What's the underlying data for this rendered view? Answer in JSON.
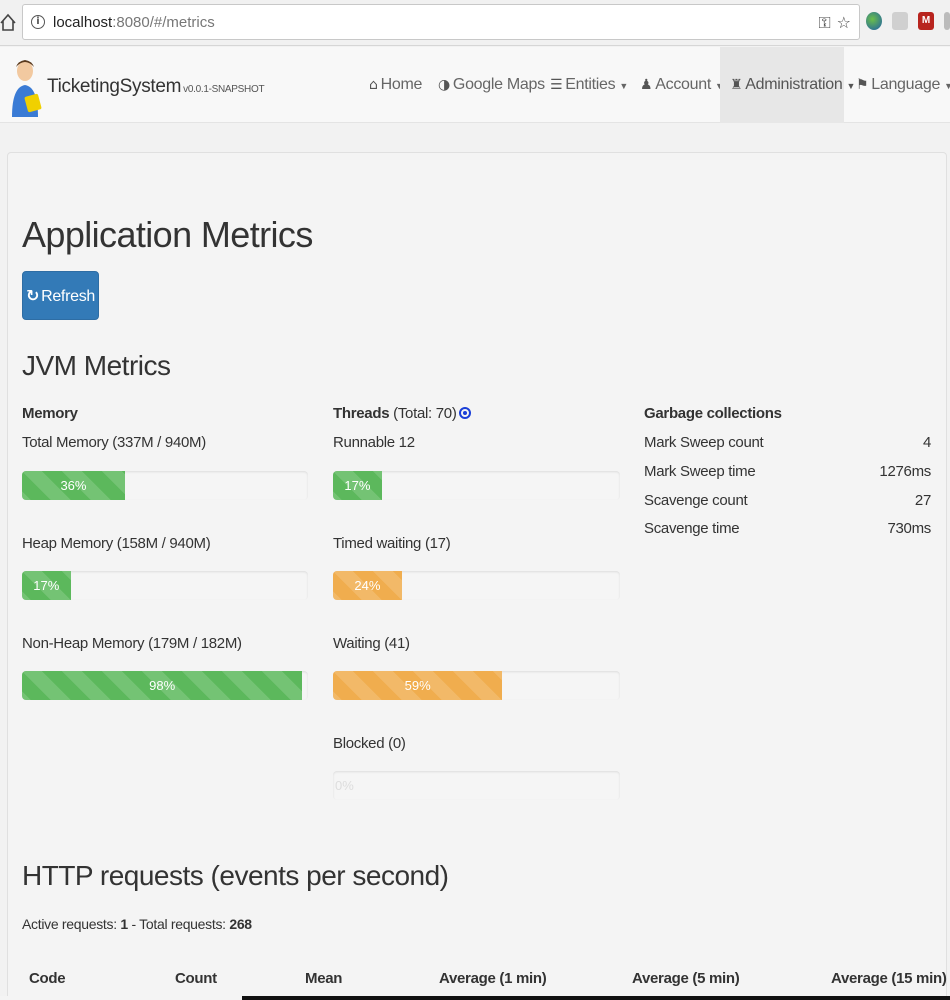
{
  "browser": {
    "url_host": "localhost",
    "url_rest": ":8080/#/metrics"
  },
  "navbar": {
    "brand": "TicketingSystem",
    "version": "v0.0.1-SNAPSHOT",
    "items": [
      {
        "label": "Home",
        "icon": "home-icon"
      },
      {
        "label": "Google Maps",
        "icon": "globe-icon"
      },
      {
        "label": "Entities",
        "icon": "list-icon"
      },
      {
        "label": "Account",
        "icon": "user-icon"
      },
      {
        "label": "Administration",
        "icon": "tower-icon"
      },
      {
        "label": "Language",
        "icon": "flag-icon"
      }
    ]
  },
  "page": {
    "title": "Application Metrics",
    "refresh_label": "Refresh"
  },
  "jvm": {
    "title": "JVM Metrics",
    "memory": {
      "heading": "Memory",
      "items": [
        {
          "label": "Total Memory (337M / 940M)",
          "percent": 36,
          "text": "36%"
        },
        {
          "label": "Heap Memory (158M / 940M)",
          "percent": 17,
          "text": "17%"
        },
        {
          "label": "Non-Heap Memory (179M / 182M)",
          "percent": 98,
          "text": "98%"
        }
      ]
    },
    "threads": {
      "heading": "Threads",
      "total": "(Total: 70)",
      "items": [
        {
          "label": "Runnable 12",
          "percent": 17,
          "text": "17%"
        },
        {
          "label": "Timed waiting (17)",
          "percent": 24,
          "text": "24%"
        },
        {
          "label": "Waiting (41)",
          "percent": 59,
          "text": "59%"
        },
        {
          "label": "Blocked (0)",
          "percent": 0,
          "text": "0%"
        }
      ]
    },
    "gc": {
      "heading": "Garbage collections",
      "rows": [
        {
          "label": "Mark Sweep count",
          "value": "4"
        },
        {
          "label": "Mark Sweep time",
          "value": "1276ms"
        },
        {
          "label": "Scavenge count",
          "value": "27"
        },
        {
          "label": "Scavenge time",
          "value": "730ms"
        }
      ]
    }
  },
  "http": {
    "title": "HTTP requests (events per second)",
    "active_label": "Active requests: ",
    "active": "1",
    "total_label": " - Total requests: ",
    "total": "268",
    "columns": [
      "Code",
      "Count",
      "Mean",
      "Average (1 min)",
      "Average (5 min)",
      "Average (15 min)"
    ]
  },
  "colors": {
    "success": "#5cb85c",
    "warning": "#f0ad4e",
    "primary": "#337ab7"
  }
}
